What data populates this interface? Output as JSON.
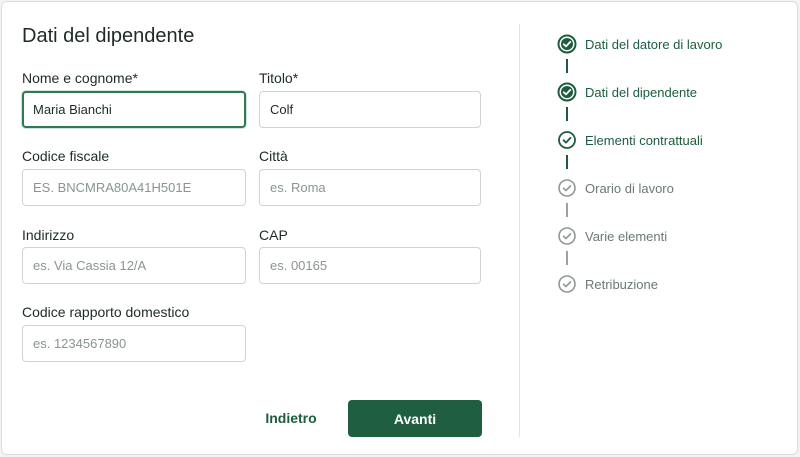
{
  "form": {
    "title": "Dati del dipendente",
    "fields": {
      "nome": {
        "label": "Nome e cognome*",
        "value": "Maria Bianchi",
        "placeholder": ""
      },
      "titolo": {
        "label": "Titolo*",
        "value": "Colf",
        "placeholder": ""
      },
      "codice_fiscale": {
        "label": "Codice fiscale",
        "value": "",
        "placeholder": "ES. BNCMRA80A41H501E"
      },
      "citta": {
        "label": "Città",
        "value": "",
        "placeholder": "es. Roma"
      },
      "indirizzo": {
        "label": "Indirizzo",
        "value": "",
        "placeholder": "es. Via Cassia 12/A"
      },
      "cap": {
        "label": "CAP",
        "value": "",
        "placeholder": "es. 00165"
      },
      "codice_rapporto": {
        "label": "Codice rapporto domestico",
        "value": "",
        "placeholder": "es. 1234567890"
      }
    },
    "buttons": {
      "back": "Indietro",
      "next": "Avanti"
    }
  },
  "steps": [
    {
      "label": "Dati del datore di lavoro",
      "status": "completed",
      "icon": "check-circle-icon"
    },
    {
      "label": "Dati del dipendente",
      "status": "current",
      "icon": "check-circle-icon"
    },
    {
      "label": "Elementi contrattuali",
      "status": "completed",
      "icon": "check-circle-icon"
    },
    {
      "label": "Orario di lavoro",
      "status": "pending",
      "icon": "check-circle-outline-icon"
    },
    {
      "label": "Varie elementi",
      "status": "pending",
      "icon": "check-circle-outline-icon"
    },
    {
      "label": "Retribuzione",
      "status": "pending",
      "icon": "check-circle-outline-icon"
    }
  ],
  "colors": {
    "accent": "#1f5e3f",
    "pending": "#9aa3a0",
    "focus": "#2f7a55"
  }
}
